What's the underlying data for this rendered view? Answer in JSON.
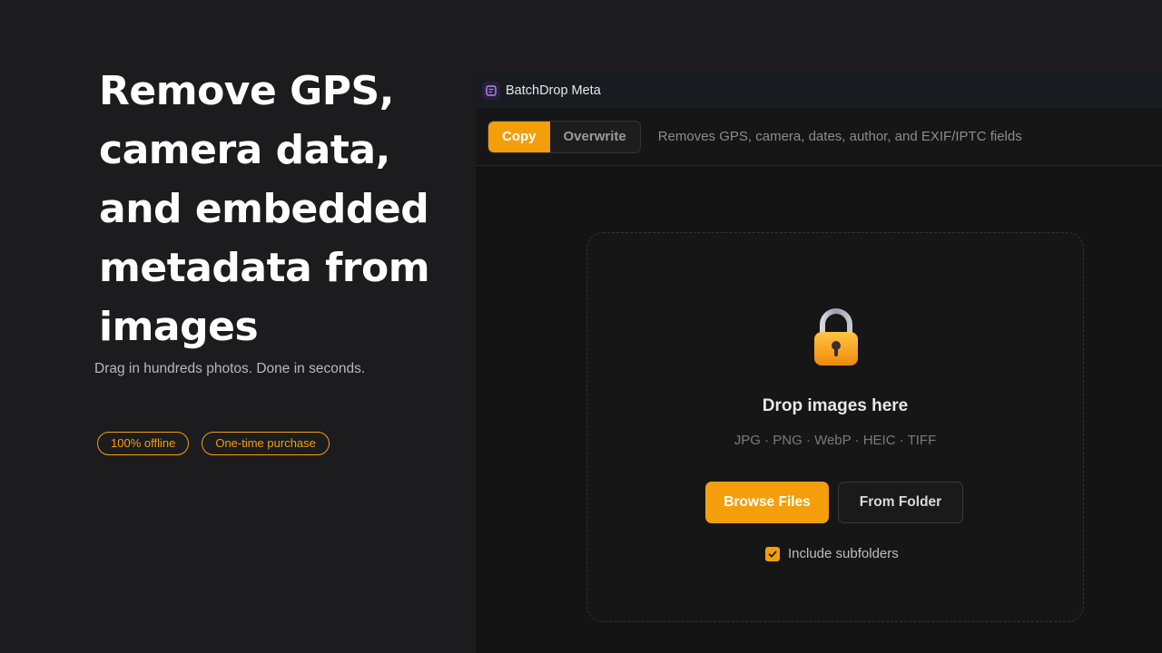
{
  "hero": {
    "title": "Remove GPS, camera data, and embedded metadata from images",
    "subtitle": "Drag in hundreds photos. Done in seconds.",
    "pills": [
      "100% offline",
      "One-time purchase"
    ]
  },
  "app": {
    "title": "BatchDrop Meta",
    "mode_options": [
      "Copy",
      "Overwrite"
    ],
    "selected_mode": "Copy",
    "mode_description": "Removes GPS, camera, dates, author, and EXIF/IPTC fields",
    "dropzone": {
      "icon": "lock-icon",
      "title": "Drop images here",
      "formats": "JPG · PNG · WebP · HEIC · TIFF",
      "browse_label": "Browse Files",
      "folder_label": "From Folder",
      "subfolders_label": "Include subfolders",
      "subfolders_checked": true
    }
  },
  "colors": {
    "accent": "#f59e0b",
    "background": "#1c1c1e",
    "app_background": "#141414"
  }
}
